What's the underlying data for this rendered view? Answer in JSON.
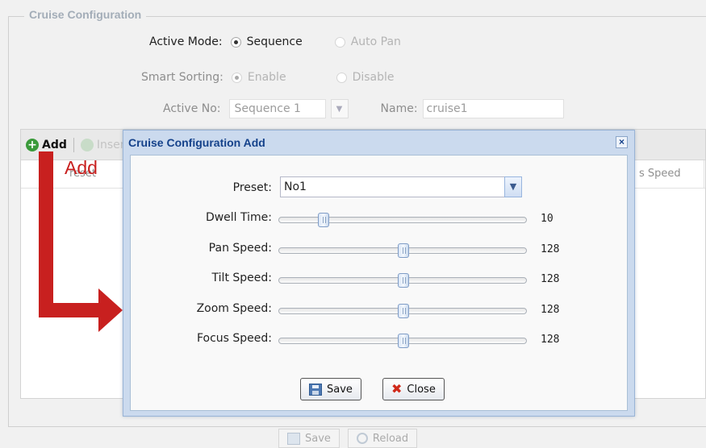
{
  "config": {
    "legend": "Cruise Configuration",
    "active_mode": {
      "label": "Active Mode:",
      "option1": "Sequence",
      "option2": "Auto Pan"
    },
    "smart_sorting": {
      "label": "Smart Sorting:",
      "option1": "Enable",
      "option2": "Disable"
    },
    "active_no": {
      "label": "Active No:",
      "value": "Sequence 1"
    },
    "name": {
      "label": "Name:",
      "value": "cruise1"
    }
  },
  "grid": {
    "add_label": "Add",
    "insert_label": "Inser",
    "col_speed": "s Speed",
    "col_preset": "reset"
  },
  "annotation": {
    "text": "Add",
    "color": "#c8201f"
  },
  "dialog": {
    "title": "Cruise Configuration Add",
    "close_glyph": "×",
    "preset": {
      "label": "Preset:",
      "value": "No1"
    },
    "sliders": [
      {
        "label": "Dwell Time:",
        "value": "10",
        "fraction": 0.18
      },
      {
        "label": "Pan Speed:",
        "value": "128",
        "fraction": 0.5
      },
      {
        "label": "Tilt Speed:",
        "value": "128",
        "fraction": 0.5
      },
      {
        "label": "Zoom Speed:",
        "value": "128",
        "fraction": 0.5
      },
      {
        "label": "Focus Speed:",
        "value": "128",
        "fraction": 0.5
      }
    ],
    "save_label": "Save",
    "close_label": "Close"
  },
  "bottom": {
    "save_label": "Save",
    "reload_label": "Reload"
  },
  "colors": {
    "title_text": "#15428b",
    "dialog_bg": "#cbdaee",
    "accent_red": "#c8201f"
  }
}
